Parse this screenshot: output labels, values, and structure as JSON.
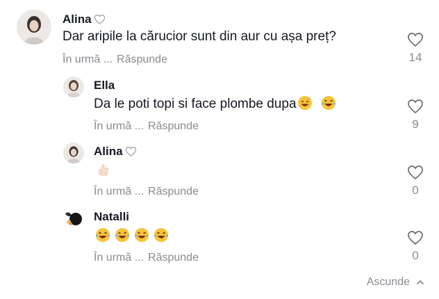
{
  "comments": [
    {
      "author": "Alina",
      "text": "Dar aripile la cărucior sunt din aur cu așa preț?",
      "time": "În urmă ...",
      "reply": "Răspunde",
      "likes": "14"
    },
    {
      "author": "Ella",
      "text": "Da le poti topi si face plombe dupa",
      "time": "În urmă ...",
      "reply": "Răspunde",
      "likes": "9",
      "emojis": [
        "smiling-face-with-sweat-emoji",
        "tears-of-joy-emoji"
      ]
    },
    {
      "author": "Alina",
      "text": "",
      "time": "În urmă ...",
      "reply": "Răspunde",
      "likes": "0",
      "emojis": [
        "thumbs-up-emoji"
      ]
    },
    {
      "author": "Natalli",
      "text": "",
      "time": "În urmă ...",
      "reply": "Răspunde",
      "likes": "0",
      "emojis": [
        "tears-of-joy-emoji",
        "tears-of-joy-emoji",
        "tears-of-joy-emoji",
        "tears-of-joy-emoji"
      ]
    }
  ],
  "footer": {
    "hide_label": "Ascunde"
  },
  "colors": {
    "text": "#161823",
    "muted": "#8a8b91",
    "icon": "#6b6b70"
  }
}
